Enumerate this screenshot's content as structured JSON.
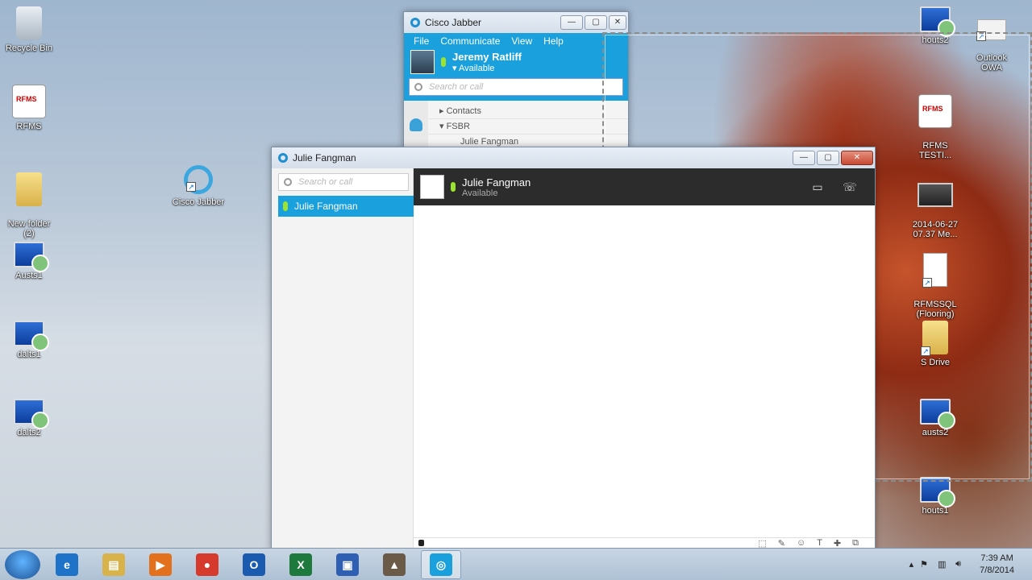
{
  "desktop": {
    "icons_left": [
      {
        "label": "Recycle Bin",
        "icon": "recycle-bin-icon"
      },
      {
        "label": "RFMS",
        "icon": "rfms-icon"
      },
      {
        "label": "New folder\n(2)",
        "icon": "folder-icon"
      },
      {
        "label": "Austs1",
        "icon": "remote-desktop-icon"
      },
      {
        "label": "dalts1",
        "icon": "remote-desktop-icon"
      },
      {
        "label": "dalts2",
        "icon": "remote-desktop-icon"
      }
    ],
    "icon_jabber": {
      "label": "Cisco Jabber",
      "icon": "cisco-jabber-icon"
    },
    "icons_right": [
      {
        "label": "houts2",
        "icon": "remote-desktop-icon"
      },
      {
        "label": "Outlook\nOWA",
        "icon": "outlook-owa-icon"
      },
      {
        "label": "RFMS\nTESTI...",
        "icon": "rfms-icon"
      },
      {
        "label": "2014-06-27\n07.37 Me...",
        "icon": "video-file-icon"
      },
      {
        "label": "RFMSSQL\n(Flooring)",
        "icon": "file-icon"
      },
      {
        "label": "S Drive",
        "icon": "folder-icon"
      },
      {
        "label": "austs2",
        "icon": "remote-desktop-icon"
      },
      {
        "label": "houts1",
        "icon": "remote-desktop-icon"
      }
    ]
  },
  "jabber_main": {
    "title": "Cisco Jabber",
    "menu": [
      "File",
      "Communicate",
      "View",
      "Help"
    ],
    "user_name": "Jeremy Ratliff",
    "user_status": "Available",
    "search_placeholder": "Search or call",
    "groups": [
      "Contacts",
      "FSBR",
      "Julie Fangman"
    ]
  },
  "chat_window": {
    "title": "Julie Fangman",
    "search_placeholder": "Search or call",
    "conversation_item": "Julie Fangman",
    "contact_name": "Julie Fangman",
    "contact_status": "Available"
  },
  "taskbar": {
    "apps": [
      {
        "name": "internet-explorer",
        "glyph": "e",
        "color": "#1e73c9"
      },
      {
        "name": "file-explorer",
        "glyph": "▤",
        "color": "#d8b24a"
      },
      {
        "name": "media-player",
        "glyph": "▶",
        "color": "#e2701c"
      },
      {
        "name": "chrome",
        "glyph": "●",
        "color": "#d63a2c"
      },
      {
        "name": "outlook",
        "glyph": "O",
        "color": "#1a5bb0"
      },
      {
        "name": "excel",
        "glyph": "X",
        "color": "#1e7a3c"
      },
      {
        "name": "remote-desktop",
        "glyph": "▣",
        "color": "#2f5fb3"
      },
      {
        "name": "network-app",
        "glyph": "▲",
        "color": "#6b5a48"
      },
      {
        "name": "cisco-jabber",
        "glyph": "◎",
        "color": "#1aa1dd"
      }
    ],
    "time": "7:39 AM",
    "date": "7/8/2014"
  }
}
